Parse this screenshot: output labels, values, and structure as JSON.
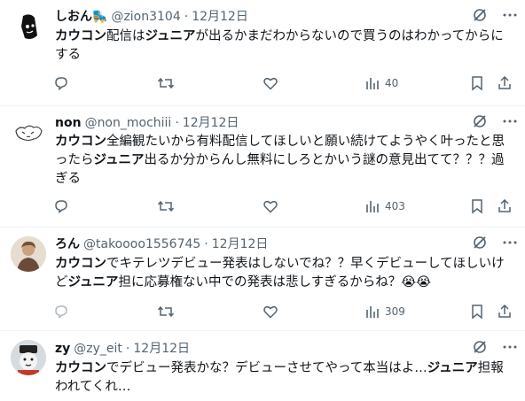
{
  "tweets": [
    {
      "display_name": "しおん🛼",
      "handle": "@zion3104",
      "separator": "·",
      "date": "12月12日",
      "text_segments": [
        {
          "t": "カウコン",
          "b": true
        },
        {
          "t": "配信は",
          "b": false
        },
        {
          "t": "ジュニア",
          "b": true
        },
        {
          "t": "が出るかまだわからないので買うのはわかってからにする",
          "b": false
        }
      ],
      "views": "40",
      "avatar": "black-white-character"
    },
    {
      "display_name": "non",
      "handle": "@non_mochiii",
      "separator": "·",
      "date": "12月12日",
      "text_segments": [
        {
          "t": "カウコン",
          "b": true
        },
        {
          "t": "全編観たいから有料配信してほしいと願い続けてようやく叶ったと思ったら",
          "b": false
        },
        {
          "t": "ジュニア",
          "b": true
        },
        {
          "t": "出るか分からんし無料にしろとかいう謎の意見出てて？？？過ぎる",
          "b": false
        }
      ],
      "views": "403",
      "avatar": "doodle-face"
    },
    {
      "display_name": "ろん",
      "handle": "@takoooo1556745",
      "separator": "·",
      "date": "12月12日",
      "text_segments": [
        {
          "t": "カウコン",
          "b": true
        },
        {
          "t": "でキテレツデビュー発表はしないでね？？早くデビューしてほしいけど",
          "b": false
        },
        {
          "t": "ジュニア",
          "b": true
        },
        {
          "t": "担に応募権ない中での発表は悲しすぎるからね？",
          "b": false
        },
        {
          "t": "😭😭",
          "b": false
        }
      ],
      "views": "309",
      "avatar": "person-photo"
    },
    {
      "display_name": "zy",
      "handle": "@zy_eit",
      "separator": "·",
      "date": "12月12日",
      "text_segments": [
        {
          "t": "カウコン",
          "b": true
        },
        {
          "t": "でデビュー発表かな？デビューさせてやって本当はよ…",
          "b": false
        },
        {
          "t": "ジュニア",
          "b": true
        },
        {
          "t": "担報われてくれ…",
          "b": false
        }
      ],
      "views": "",
      "avatar": "snowman-photo"
    }
  ],
  "icons": {
    "grok": "grok-icon",
    "more": "more-icon",
    "reply": "reply-icon",
    "retweet": "retweet-icon",
    "like": "like-icon",
    "views": "views-icon",
    "bookmark": "bookmark-icon",
    "share": "share-icon"
  },
  "colors": {
    "text": "#0f1419",
    "secondary": "#536471",
    "divider": "#eff3f4"
  }
}
